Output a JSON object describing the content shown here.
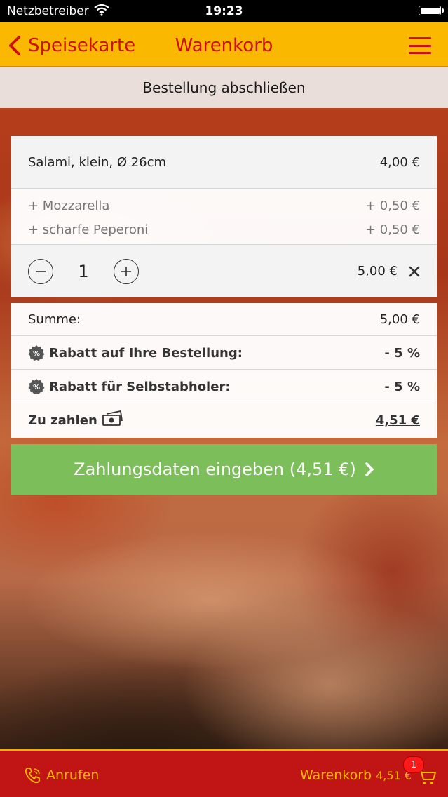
{
  "status_bar": {
    "carrier": "Netzbetreiber",
    "time": "19:23"
  },
  "nav": {
    "back_label": "Speisekarte",
    "title": "Warenkorb"
  },
  "subheader": "Bestellung abschließen",
  "order": {
    "item_name": "Salami, klein, Ø 26cm",
    "item_price": "4,00 €",
    "extras": [
      {
        "name": "+ Mozzarella",
        "price": "+ 0,50 €"
      },
      {
        "name": "+ scharfe Peperoni",
        "price": "+ 0,50 €"
      }
    ],
    "quantity": "1",
    "line_total": "5,00 €"
  },
  "summary": {
    "sum_label": "Summe:",
    "sum_value": "5,00 €",
    "discount1_label": "Rabatt auf Ihre Bestellung:",
    "discount1_value": "- 5 %",
    "discount2_label": "Rabatt für Selbstabholer:",
    "discount2_value": "- 5 %",
    "total_label": "Zu zahlen",
    "total_value": "4,51 €"
  },
  "pay_button_label": "Zahlungsdaten eingeben (4,51 €)",
  "footer": {
    "call_label": "Anrufen",
    "cart_label": "Warenkorb",
    "cart_total": "4,51 €",
    "cart_badge": "1"
  },
  "colors": {
    "nav_bg": "#fbb800",
    "nav_text": "#cc1010",
    "pay_button": "#7cbf5a",
    "footer_bg": "#c11414",
    "footer_text": "#fbb800",
    "badge": "#ff1a1a"
  }
}
